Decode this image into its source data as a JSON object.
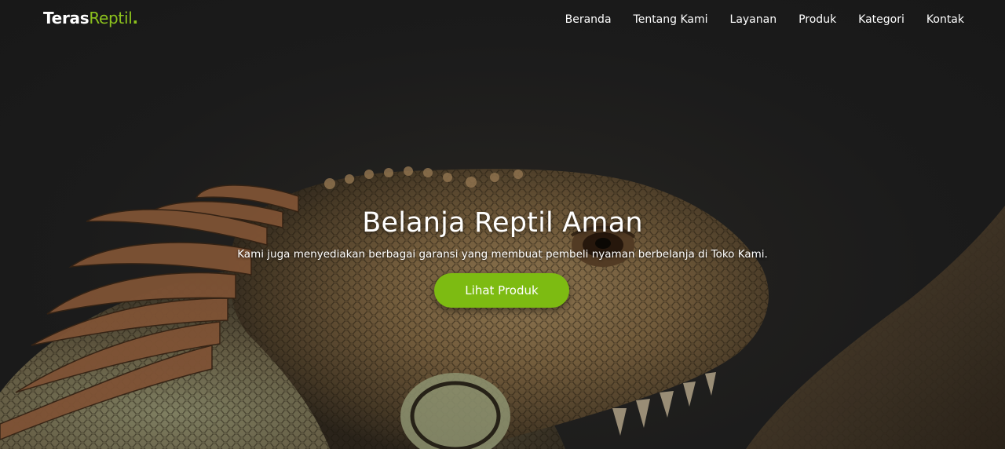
{
  "brand": {
    "part1": "Teras",
    "part2": "Reptil",
    "dot": "."
  },
  "nav": {
    "items": [
      {
        "label": "Beranda"
      },
      {
        "label": "Tentang Kami"
      },
      {
        "label": "Layanan"
      },
      {
        "label": "Produk"
      },
      {
        "label": "Kategori"
      },
      {
        "label": "Kontak"
      }
    ]
  },
  "hero": {
    "title": "Belanja Reptil Aman",
    "subtitle": "Kami juga menyediakan berbagai garansi yang membuat pembeli nyaman berbelanja di Toko Kami.",
    "cta_label": "Lihat Produk",
    "background_image": "iguana-photo"
  },
  "colors": {
    "accent": "#7dbb12",
    "background": "#1f1f1f",
    "text": "#ffffff"
  }
}
